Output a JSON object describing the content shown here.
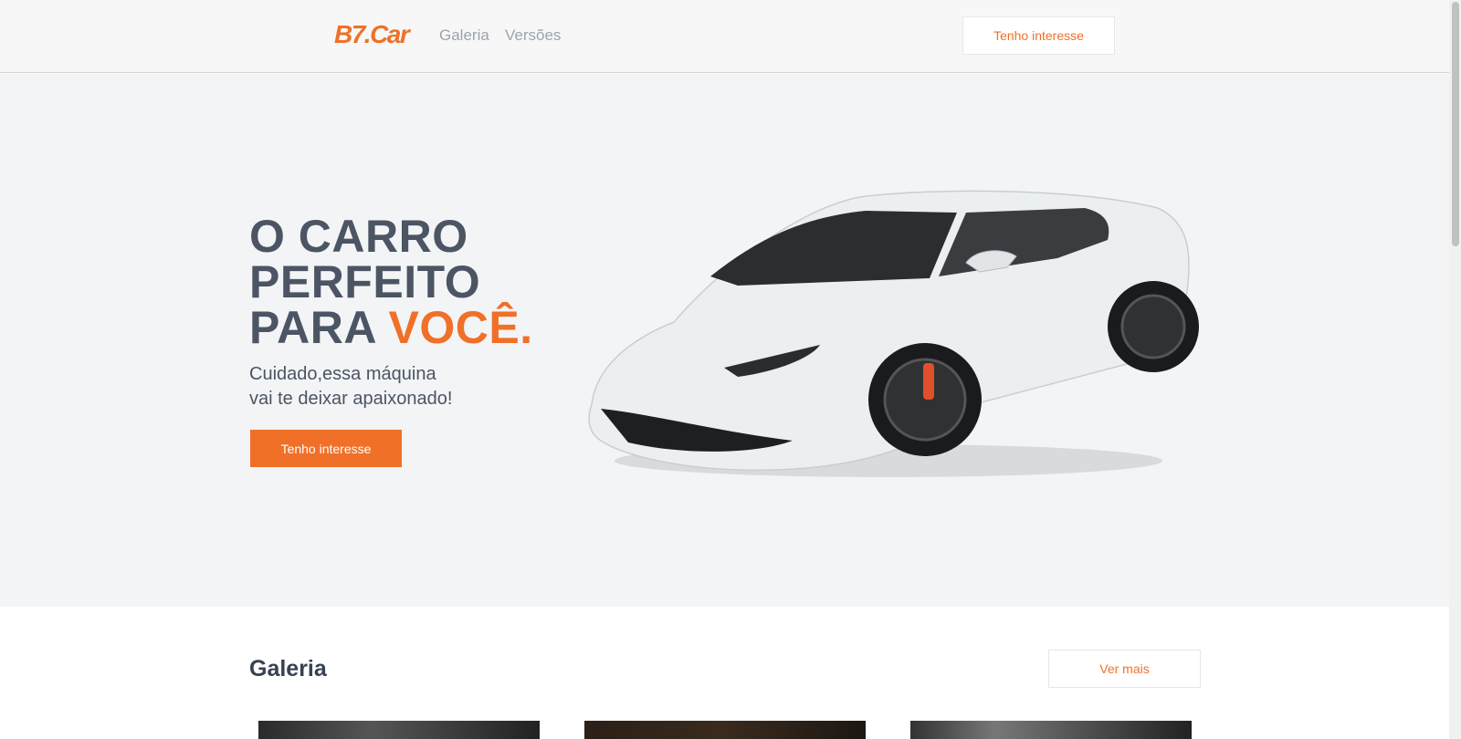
{
  "header": {
    "logo": "B7.Car",
    "nav": [
      "Galeria",
      "Versões"
    ],
    "cta_label": "Tenho interesse"
  },
  "hero": {
    "title_line1": "O CARRO",
    "title_line2": "PERFEITO",
    "title_line3_prefix": "PARA ",
    "title_line3_accent": "VOCÊ.",
    "subtitle_line1": "Cuidado,essa máquina",
    "subtitle_line2": "vai te deixar apaixonado!",
    "cta_label": "Tenho interesse"
  },
  "gallery": {
    "title": "Galeria",
    "more_label": "Ver mais",
    "images": [
      "car-photo-1",
      "car-photo-2",
      "car-photo-3"
    ]
  },
  "colors": {
    "accent": "#f07028",
    "text_dark": "#4b5563",
    "hero_bg": "#f3f4f6",
    "header_bg": "#f7f7f7"
  },
  "icons": [
    "lamborghini-car-image"
  ]
}
